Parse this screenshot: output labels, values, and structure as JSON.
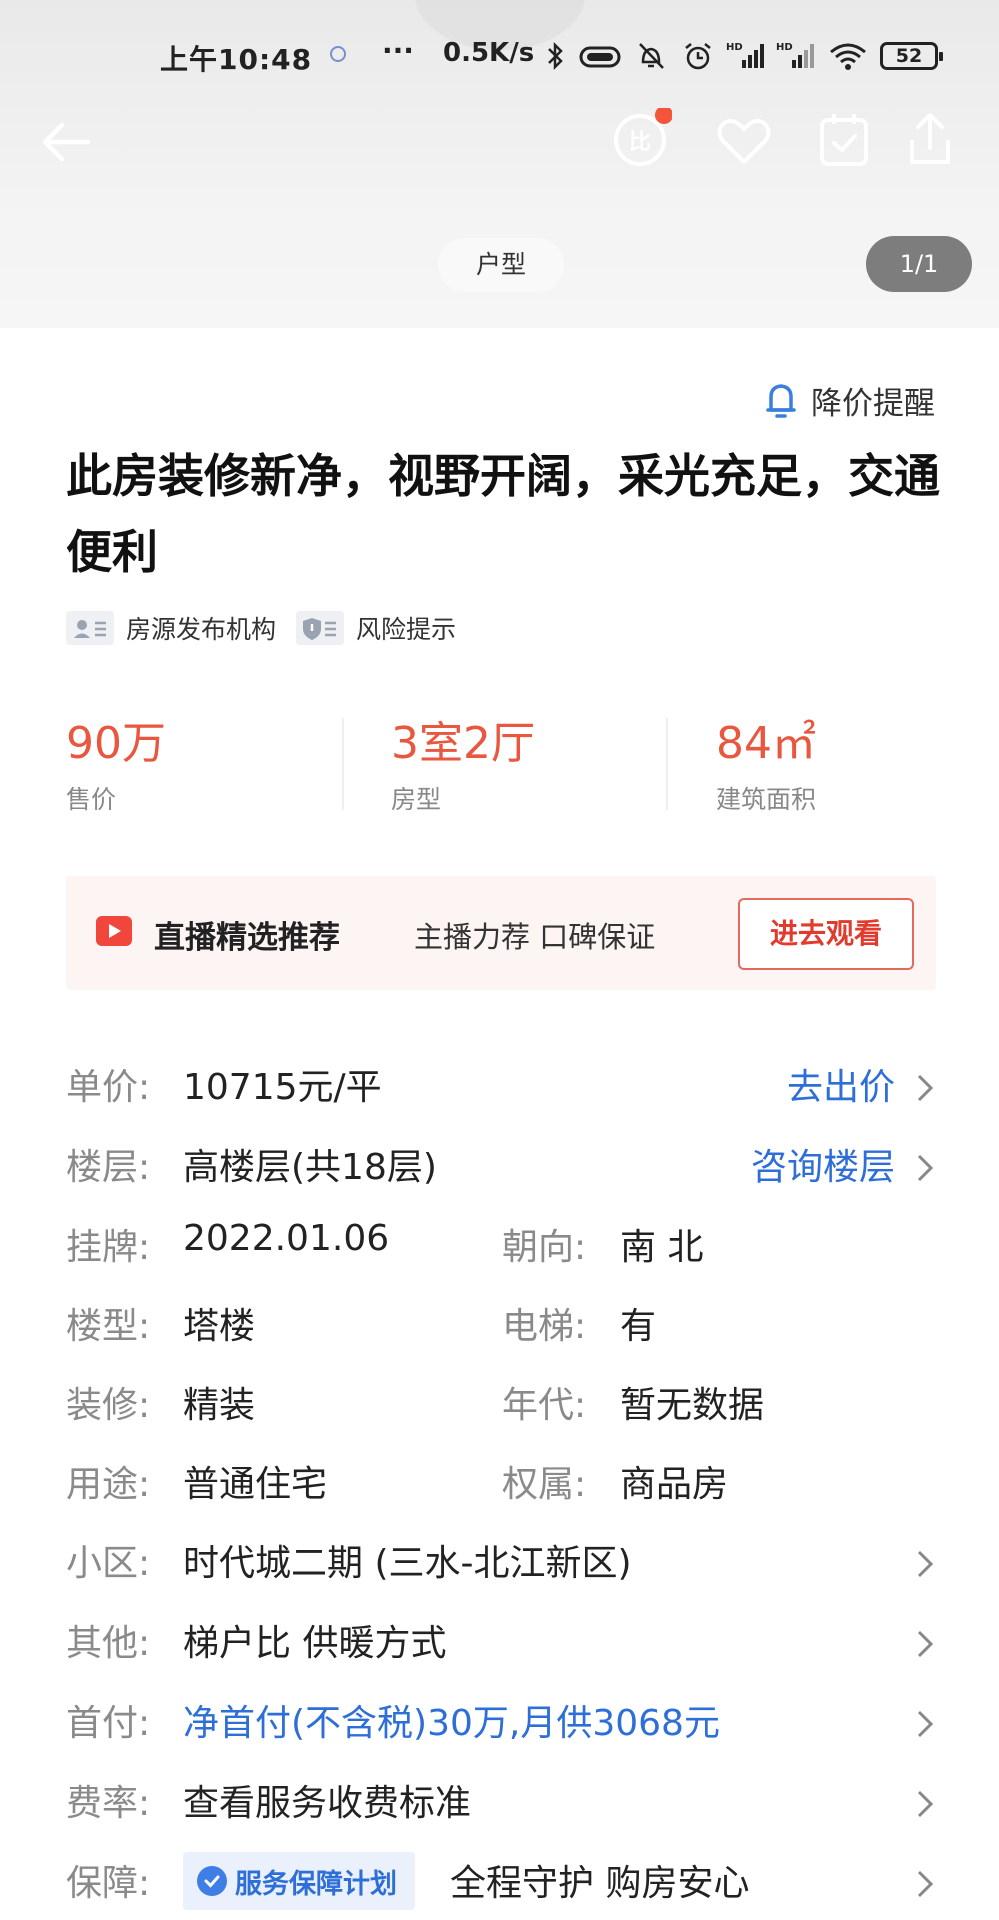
{
  "status_bar": {
    "time": "上午10:48",
    "more": "···",
    "speed": "0.5K/s",
    "battery": "52"
  },
  "hero": {
    "tab_label": "户型",
    "pager": "1/1"
  },
  "alert": {
    "label": "降价提醒"
  },
  "title": "此房装修新净，视野开阔，采光充足，交通便利",
  "tags": [
    {
      "label": "房源发布机构",
      "icon": "agency-card-icon"
    },
    {
      "label": "风险提示",
      "icon": "risk-shield-icon"
    }
  ],
  "stats": [
    {
      "value": "90万",
      "label": "售价"
    },
    {
      "value": "3室2厅",
      "label": "房型"
    },
    {
      "value": "84㎡",
      "label": "建筑面积"
    }
  ],
  "live": {
    "title": "直播精选推荐",
    "subtitle": "主播力荐 口碑保证",
    "button": "进去观看"
  },
  "details": {
    "unit_price": {
      "key": "单价:",
      "value": "10715元/平",
      "action": "去出价"
    },
    "floor": {
      "key": "楼层:",
      "value": "高楼层(共18层)",
      "action": "咨询楼层"
    },
    "listing": {
      "key": "挂牌:",
      "value": "2022.01.06",
      "key2": "朝向:",
      "value2": "南 北"
    },
    "building": {
      "key": "楼型:",
      "value": "塔楼",
      "key2": "电梯:",
      "value2": "有"
    },
    "decoration": {
      "key": "装修:",
      "value": "精装",
      "key2": "年代:",
      "value2": "暂无数据"
    },
    "usage": {
      "key": "用途:",
      "value": "普通住宅",
      "key2": "权属:",
      "value2": "商品房"
    },
    "community": {
      "key": "小区:",
      "value": "时代城二期 (三水-北江新区)"
    },
    "other": {
      "key": "其他:",
      "value": "梯户比 供暖方式"
    },
    "down_payment": {
      "key": "首付:",
      "value": "净首付(不含税)30万,月供3068元"
    },
    "fee": {
      "key": "费率:",
      "value": "查看服务收费标准"
    },
    "guarantee": {
      "key": "保障:",
      "badge": "服务保障计划",
      "value": "全程守护 购房安心"
    }
  },
  "colors": {
    "accent_red": "#e9573f",
    "link_blue": "#2e6ed8",
    "live_bg": "#fdf4f4"
  }
}
